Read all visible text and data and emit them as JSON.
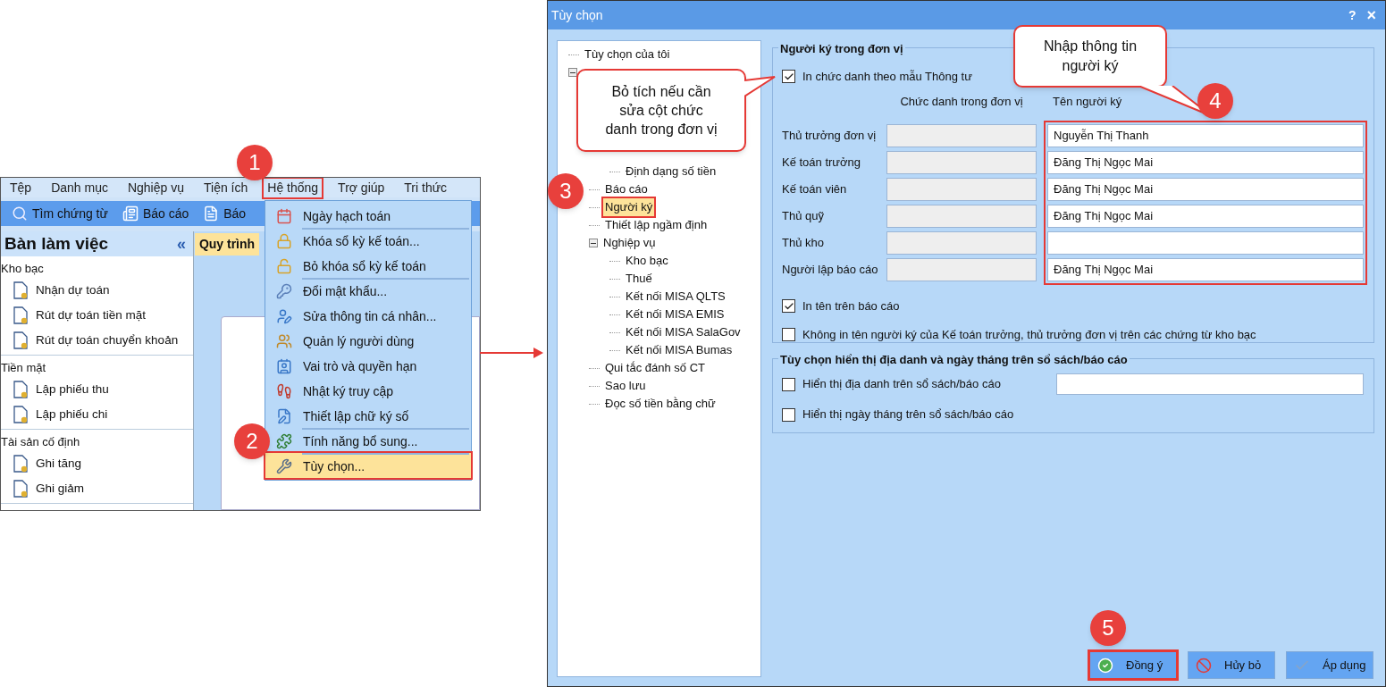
{
  "left_app": {
    "menu_bar": [
      {
        "label": "Tệp",
        "highlighted": false
      },
      {
        "label": "Danh mục",
        "highlighted": false
      },
      {
        "label": "Nghiệp vụ",
        "highlighted": false
      },
      {
        "label": "Tiện ích",
        "highlighted": false
      },
      {
        "label": "Hệ thống",
        "highlighted": true
      },
      {
        "label": "Trợ giúp",
        "highlighted": false
      },
      {
        "label": "Tri thức",
        "highlighted": false
      }
    ],
    "toolbar": [
      {
        "label": "Tìm chứng từ"
      },
      {
        "label": "Báo cáo"
      },
      {
        "label": "Báo"
      }
    ],
    "sidebar": {
      "title": "Bàn làm việc",
      "collapse": "«",
      "groups": [
        {
          "title": "Kho bạc",
          "items": [
            "Nhận dự toán",
            "Rút dự toán tiền mặt",
            "Rút dự toán chuyển khoản"
          ]
        },
        {
          "title": "Tiền mặt",
          "items": [
            "Lập phiếu thu",
            "Lập phiếu chi"
          ]
        },
        {
          "title": "Tài sản cố định",
          "items": [
            "Ghi tăng",
            "Ghi giảm"
          ]
        }
      ]
    },
    "tab": "Quy trình",
    "dropdown": [
      {
        "label": "Ngày hạch toán",
        "selected": false,
        "highlighted": false,
        "divider_before": false
      },
      {
        "label": "Khóa sổ kỳ kế toán...",
        "selected": false,
        "highlighted": false,
        "divider_before": true
      },
      {
        "label": "Bỏ khóa sổ kỳ kế toán",
        "selected": false,
        "highlighted": false,
        "divider_before": false
      },
      {
        "label": "Đổi mật khẩu...",
        "selected": false,
        "highlighted": false,
        "divider_before": true
      },
      {
        "label": "Sửa thông tin cá nhân...",
        "selected": false,
        "highlighted": false,
        "divider_before": false
      },
      {
        "label": "Quản lý người dùng",
        "selected": false,
        "highlighted": false,
        "divider_before": false
      },
      {
        "label": "Vai trò và quyền hạn",
        "selected": false,
        "highlighted": false,
        "divider_before": false
      },
      {
        "label": "Nhật ký truy cập",
        "selected": false,
        "highlighted": false,
        "divider_before": false
      },
      {
        "label": "Thiết lập chữ ký số",
        "selected": false,
        "highlighted": false,
        "divider_before": false
      },
      {
        "label": "Tính năng bổ sung...",
        "selected": false,
        "highlighted": false,
        "divider_before": true
      },
      {
        "label": "Tùy chọn...",
        "selected": true,
        "highlighted": true,
        "divider_before": true
      }
    ]
  },
  "dialog": {
    "title": "Tùy chọn",
    "help": "?",
    "close": "×",
    "tree": [
      {
        "label": "Tùy chọn của tôi",
        "selected": false
      },
      {
        "expanded": true,
        "children": [
          {
            "children": [
              {
                "label": "Định dạng số tiền",
                "selected": false
              }
            ]
          },
          {
            "label": "Báo cáo",
            "selected": false
          },
          {
            "label": "Người ký",
            "selected": true,
            "highlighted": true
          },
          {
            "label": "Thiết lập ngầm định",
            "selected": false
          },
          {
            "label": "Nghiệp vụ",
            "selected": false,
            "expanded": true,
            "children": [
              {
                "label": "Kho bạc",
                "selected": false
              },
              {
                "label": "Thuế",
                "selected": false
              },
              {
                "label": "Kết nối MISA QLTS",
                "selected": false
              },
              {
                "label": "Kết nối MISA EMIS",
                "selected": false
              },
              {
                "label": "Kết nối MISA SalaGov",
                "selected": false
              },
              {
                "label": "Kết nối MISA Bumas",
                "selected": false
              }
            ]
          },
          {
            "label": "Qui tắc đánh số CT",
            "selected": false
          },
          {
            "label": "Sao lưu",
            "selected": false
          },
          {
            "label": "Đọc số tiền bằng chữ",
            "selected": false
          }
        ]
      }
    ],
    "signers_group": {
      "title": "Người ký trong đơn vị",
      "print_title": {
        "label": "In chức danh theo mẫu Thông tư",
        "checked": true
      },
      "column_headers": [
        "Chức danh trong đơn vị",
        "Tên người ký"
      ],
      "names_highlighted": true,
      "rows": [
        {
          "label": "Thủ trưởng đơn vị",
          "title_disabled": true,
          "name": "Nguyễn Thị Thanh"
        },
        {
          "label": "Kế toán trưởng",
          "title_disabled": true,
          "name": "Đăng Thị Ngọc Mai"
        },
        {
          "label": "Kế toán viên",
          "title_disabled": true,
          "name": "Đăng Thị Ngọc Mai"
        },
        {
          "label": "Thủ quỹ",
          "title_disabled": true,
          "name": "Đăng Thị Ngọc Mai"
        },
        {
          "label": "Thủ kho",
          "title_disabled": true
        },
        {
          "label": "Người lập báo cáo",
          "title_disabled": true,
          "name": "Đăng Thị Ngọc Mai"
        }
      ],
      "options": [
        {
          "label": "In tên trên báo cáo",
          "checked": true
        },
        {
          "label": "Không in tên người ký của Kế toán trưởng, thủ trưởng đơn vị trên các chứng từ kho bạc",
          "checked": false
        }
      ]
    },
    "display_group": {
      "title": "Tùy chọn hiển thị địa danh và ngày tháng trên sổ sách/báo cáo",
      "options": [
        {
          "label": "Hiển thị địa danh trên sổ sách/báo cáo",
          "checked": false,
          "kind": "with_field"
        },
        {
          "label": "Hiển thị ngày tháng trên sổ sách/báo cáo",
          "checked": false,
          "kind": "plain"
        }
      ]
    },
    "buttons": [
      {
        "label": "Đồng ý",
        "kind": "ok",
        "highlighted": true
      },
      {
        "label": "Hủy bỏ",
        "kind": "cancel",
        "highlighted": false
      },
      {
        "label": "Áp dụng",
        "kind": "apply",
        "highlighted": false
      }
    ]
  },
  "callouts": [
    "Bỏ tích nếu cần\nsửa cột chức\ndanh trong đơn vị",
    "Nhập thông tin\nngười ký"
  ],
  "steps": [
    "1",
    "2",
    "3",
    "4",
    "5"
  ]
}
